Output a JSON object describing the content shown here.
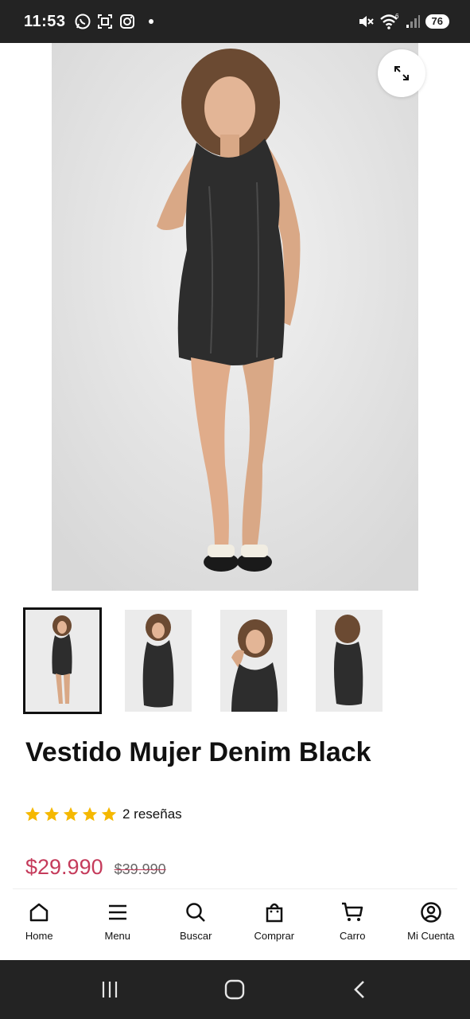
{
  "status_bar": {
    "time": "11:53",
    "battery": "76",
    "left_icons": [
      "whatsapp-icon",
      "screenshot-icon",
      "instagram-icon",
      "dot-icon"
    ],
    "right_icons": [
      "mute-icon",
      "wifi-icon",
      "signal-icon"
    ],
    "wifi_badge": "6"
  },
  "product": {
    "title": "Vestido Mujer Denim Black",
    "rating_stars": 5,
    "reviews_label": "2 reseñas",
    "price_current": "$29.990",
    "price_old": "$39.990"
  },
  "gallery": {
    "thumbnails_count": 4,
    "active_index": 0
  },
  "bottom_nav": {
    "items": [
      {
        "label": "Home",
        "icon": "home-icon"
      },
      {
        "label": "Menu",
        "icon": "menu-icon"
      },
      {
        "label": "Buscar",
        "icon": "search-icon"
      },
      {
        "label": "Comprar",
        "icon": "shopping-bag-icon"
      },
      {
        "label": "Carro",
        "icon": "cart-icon"
      },
      {
        "label": "Mi Cuenta",
        "icon": "account-icon"
      }
    ]
  },
  "colors": {
    "price": "#c53b5b",
    "star": "#f5b800",
    "status_bar": "#232323"
  }
}
